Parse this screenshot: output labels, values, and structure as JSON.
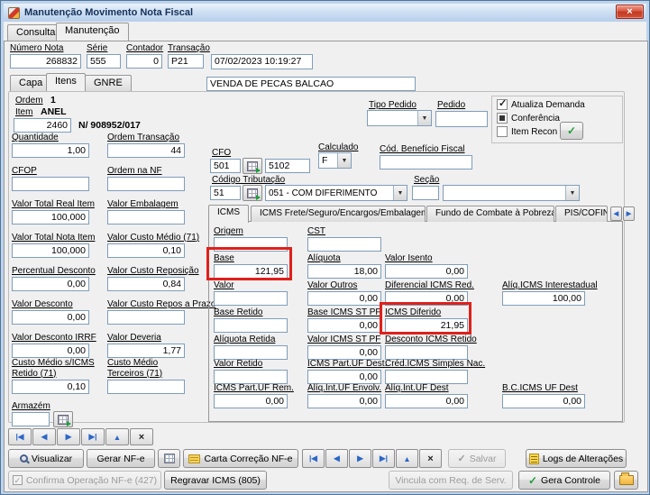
{
  "window": {
    "title": "Manutenção Movimento Nota Fiscal"
  },
  "icons": {
    "close": "×",
    "dropdown": "▼",
    "check": "✓",
    "scroll_left": "◀",
    "scroll_right": "▶"
  },
  "main_tabs": {
    "consulta": "Consulta",
    "manutencao": "Manutenção"
  },
  "header": {
    "numero_nota": {
      "label": "Número Nota",
      "value": "268832"
    },
    "serie": {
      "label": "Série",
      "value": "555"
    },
    "contador": {
      "label": "Contador",
      "value": "0"
    },
    "transacao": {
      "label": "Transação",
      "value": "P21"
    },
    "datetime": "07/02/2023 10:19:27"
  },
  "sub_tabs": {
    "capa": "Capa",
    "itens": "Itens",
    "gnre": "GNRE"
  },
  "descricao": "VENDA DE PECAS BALCAO",
  "item_bar": {
    "ordem_label": "Ordem",
    "ordem_value": "1",
    "item_label": "Item",
    "item_name": "ANEL",
    "item_code": "2460",
    "item_ref": "N/ 908952/017"
  },
  "pedido": {
    "tipo_label": "Tipo Pedido",
    "tipo_value": "",
    "pedido_label": "Pedido",
    "pedido_value": ""
  },
  "checks": {
    "atualiza": "Atualiza Demanda",
    "conferencia": "Conferência",
    "item_recon": "Item Recon"
  },
  "f": {
    "quantidade": {
      "label": "Quantidade",
      "value": "1,00"
    },
    "cfop": {
      "label": "CFOP",
      "value": ""
    },
    "valor_total_real": {
      "label": "Valor Total Real Item",
      "value": "100,000"
    },
    "valor_total_nota": {
      "label": "Valor Total Nota Item",
      "value": "100,000"
    },
    "percentual_desconto": {
      "label": "Percentual Desconto",
      "value": "0,00"
    },
    "valor_desconto": {
      "label": "Valor Desconto",
      "value": "0,00"
    },
    "valor_desconto_irrf": {
      "label": "Valor Desconto IRRF",
      "value": "0,00"
    },
    "custo_medio_sem_icms": {
      "label": "Custo Médio s/ICMS Retido (71)",
      "value": "0,10"
    },
    "armazem": {
      "label": "Armazém",
      "value": ""
    },
    "ordem_transacao": {
      "label": "Ordem Transação",
      "value": "44"
    },
    "ordem_na_nf": {
      "label": "Ordem na NF",
      "value": ""
    },
    "valor_embalagem": {
      "label": "Valor Embalagem",
      "value": ""
    },
    "valor_custo_medio": {
      "label": "Valor Custo Médio (71)",
      "value": "0,10"
    },
    "valor_custo_reposicao": {
      "label": "Valor Custo Reposição",
      "value": "0,84"
    },
    "valor_custo_repos_prazo": {
      "label": "Valor Custo Repos a Prazo",
      "value": ""
    },
    "valor_deveria": {
      "label": "Valor Deveria",
      "value": "1,77"
    },
    "custo_medio_terceiros": {
      "label": "Custo Médio Terceiros (71)",
      "value": ""
    },
    "cfo": {
      "label": "CFO",
      "value": "501"
    },
    "cfo_destino": "5102",
    "calculado": {
      "label": "Calculado",
      "value": "F"
    },
    "cod_beneficio": {
      "label": "Cód. Benefício Fiscal",
      "value": ""
    },
    "codigo_tributacao": {
      "label": "Código Tributação",
      "value": "51"
    },
    "codigo_tributacao_desc": "051 - COM DIFERIMENTO",
    "secao": {
      "label": "Seção",
      "value": ""
    }
  },
  "icms": {
    "tabs": [
      "ICMS",
      "ICMS Frete/Seguro/Encargos/Embalagem",
      "Fundo de Combate à Pobreza",
      "PIS/COFIN"
    ],
    "f": {
      "origem": {
        "label": "Origem",
        "value": ""
      },
      "cst": {
        "label": "CST",
        "value": ""
      },
      "base": {
        "label": "Base",
        "value": "121,95"
      },
      "aliquota": {
        "label": "Alíquota",
        "value": "18,00"
      },
      "valor_isento": {
        "label": "Valor Isento",
        "value": "0,00"
      },
      "valor": {
        "label": "Valor",
        "value": ""
      },
      "valor_outros": {
        "label": "Valor Outros",
        "value": "0,00"
      },
      "diferencial_icms_red": {
        "label": "Diferencial ICMS Red.",
        "value": "0,00"
      },
      "aliq_icms_interestadual": {
        "label": "Alíq.ICMS Interestadual",
        "value": "100,00"
      },
      "base_retido": {
        "label": "Base Retido",
        "value": ""
      },
      "base_icms_st_pf": {
        "label": "Base ICMS ST PF",
        "value": "0,00"
      },
      "icms_diferido": {
        "label": "ICMS Diferido",
        "value": "21,95"
      },
      "aliquota_retida": {
        "label": "Alíquota Retida",
        "value": ""
      },
      "valor_icms_st_pf": {
        "label": "Valor ICMS ST PF",
        "value": "0,00"
      },
      "desconto_icms_retido": {
        "label": "Desconto ICMS Retido",
        "value": ""
      },
      "valor_retido": {
        "label": "Valor Retido",
        "value": ""
      },
      "icms_part_uf_dest": {
        "label": "ICMS Part.UF Dest.",
        "value": "0,00"
      },
      "cred_icms_simples": {
        "label": "Créd.ICMS Simples Nac.",
        "value": ""
      },
      "icms_part_uf_rem": {
        "label": "ICMS Part.UF Rem.",
        "value": "0,00"
      },
      "aliq_int_uf_envolv": {
        "label": "Alíq.Int.UF Envolv.",
        "value": "0,00"
      },
      "aliq_int_uf_dest": {
        "label": "Alíq.Int.UF Dest",
        "value": "0,00"
      },
      "bc_icms_uf_dest": {
        "label": "B.C.ICMS UF Dest",
        "value": "0,00"
      }
    }
  },
  "nav": {
    "first": "|◀",
    "prev": "◀",
    "next": "▶",
    "last": "▶|",
    "insert": "▲",
    "cancel": "×"
  },
  "toolbar": {
    "visualizar": "Visualizar",
    "gerar_nfe": "Gerar NF-e",
    "carta": "Carta Correção NF-e",
    "salvar": "Salvar",
    "logs": "Logs de Alterações"
  },
  "bottom": {
    "confirma": "Confirma Operação NF-e (427)",
    "regravar": "Regravar ICMS (805)",
    "vincula": "Vincula com Req. de Serv.",
    "gera": "Gera Controle"
  },
  "colors": {
    "annotation": "#e0201a",
    "green": "#1f9e3c",
    "nav_blue": "#2a66c8"
  }
}
